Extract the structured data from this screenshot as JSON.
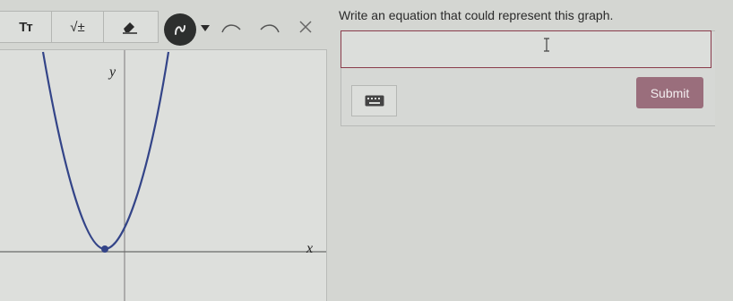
{
  "toolbar": {
    "text_tool_label": "Tт",
    "math_tool_label": "√±",
    "tools": [
      "text-format-icon",
      "square-root-icon",
      "eraser-icon",
      "freehand-draw-icon",
      "dropdown-caret-icon",
      "undo-icon",
      "redo-icon",
      "close-icon"
    ]
  },
  "question": {
    "prompt": "Write an equation that could represent this graph."
  },
  "answer": {
    "value": "",
    "submit_label": "Submit"
  },
  "graph": {
    "x_axis_label": "x",
    "y_axis_label": "y",
    "curve": "parabola opening upward, vertex left of y-axis on the x-axis"
  },
  "colors": {
    "accent": "#8a3c4c",
    "submit_bg": "#9a6e7c",
    "curve": "#334488",
    "draw_button": "#2d2f2e"
  }
}
